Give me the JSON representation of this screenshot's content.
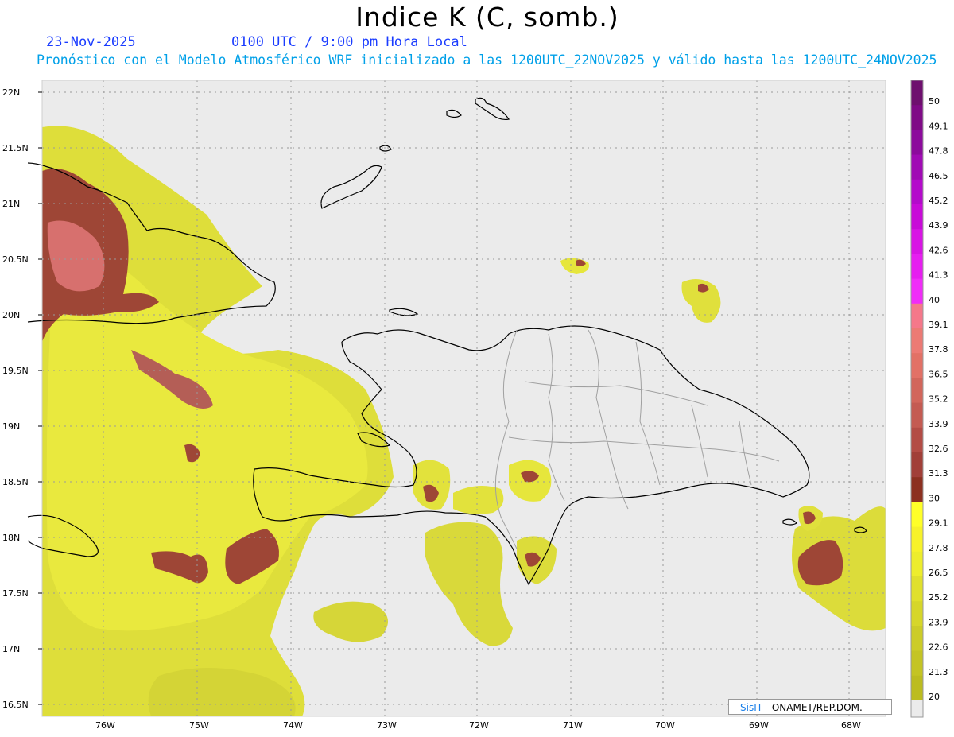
{
  "title": "Indice K (C, somb.)",
  "date": "23-Nov-2025",
  "time": "0100 UTC / 9:00 pm Hora Local",
  "subtitle": "Pronóstico con el Modelo Atmosférico WRF inicializado a las 1200UTC_22NOV2025 y válido hasta las  1200UTC_24NOV2025",
  "lat_labels": [
    "22N",
    "21.5N",
    "21N",
    "20.5N",
    "20N",
    "19.5N",
    "19N",
    "18.5N",
    "18N",
    "17.5N",
    "17N",
    "16.5N"
  ],
  "lon_labels": [
    "76W",
    "75W",
    "74W",
    "73W",
    "72W",
    "71W",
    "70W",
    "69W",
    "68W"
  ],
  "colorbar": {
    "labels": [
      "50",
      "49.1",
      "47.8",
      "46.5",
      "45.2",
      "43.9",
      "42.6",
      "41.3",
      "40",
      "39.1",
      "37.8",
      "36.5",
      "35.2",
      "33.9",
      "32.6",
      "31.3",
      "30",
      "29.1",
      "27.8",
      "26.5",
      "25.2",
      "23.9",
      "22.6",
      "21.3",
      "20"
    ],
    "colors": [
      "#6e0f6e",
      "#7f0a86",
      "#8c0a9c",
      "#a00ab4",
      "#b40acb",
      "#c80ad8",
      "#d814e4",
      "#e61ef0",
      "#f02cf8",
      "#f5788a",
      "#ec7a74",
      "#e27166",
      "#d2665b",
      "#c45b52",
      "#b34c45",
      "#a13f38",
      "#8c3020",
      "#ffff28",
      "#f7f22a",
      "#eded2c",
      "#e0e02c",
      "#d6d62a",
      "#cccc28",
      "#c4c424",
      "#bcbc20"
    ]
  },
  "colors": {
    "background": "#ebebeb",
    "field_low": "#d8d83a",
    "field_mid": "#e8e83c",
    "field_high": "#9e4636",
    "field_peak": "#e77e7e",
    "coast": "#000000",
    "border": "#a0a0a0"
  },
  "credit": {
    "brand": "SisΠ",
    "rest": " – ONAMET/REP.DOM."
  }
}
